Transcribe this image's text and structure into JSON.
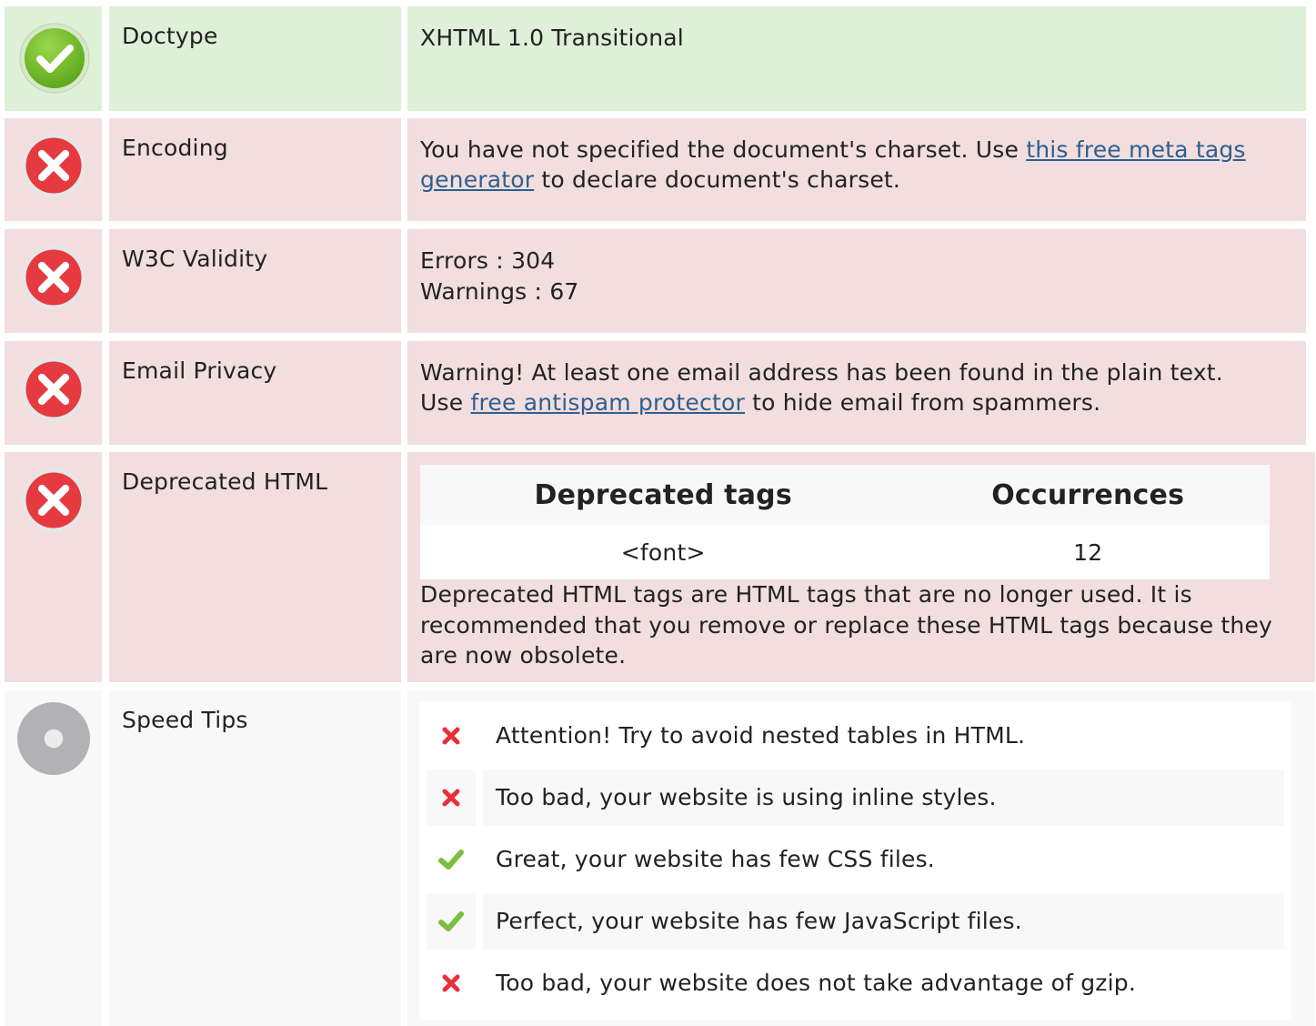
{
  "colors": {
    "ok_bg": "#dff0d8",
    "bad_bg": "#f2dede",
    "neutral_bg": "#f8f8f8",
    "link": "#2e5f8f",
    "cross": "#e8303a",
    "check": "#7cbf3e"
  },
  "doctype": {
    "label": "Doctype",
    "status_icon": "check-circle-icon",
    "value": "XHTML 1.0 Transitional"
  },
  "encoding": {
    "label": "Encoding",
    "status_icon": "error-circle-icon",
    "text_before": "You have not specified the document's charset. Use ",
    "link_text": "this free meta tags generator",
    "text_after": " to declare document's charset."
  },
  "w3c": {
    "label": "W3C Validity",
    "status_icon": "error-circle-icon",
    "errors": "Errors : 304",
    "warnings": "Warnings : 67"
  },
  "email": {
    "label": "Email Privacy",
    "status_icon": "error-circle-icon",
    "line1": "Warning! At least one email address has been found in the plain text.",
    "text_before": "Use ",
    "link_text": "free antispam protector",
    "text_after": " to hide email from spammers."
  },
  "deprecated": {
    "label": "Deprecated HTML",
    "status_icon": "error-circle-icon",
    "col_tags": "Deprecated tags",
    "col_occurrences": "Occurrences",
    "rows": [
      {
        "tag": "<font>",
        "count": "12"
      }
    ],
    "note": "Deprecated HTML tags are HTML tags that are no longer used. It is recommended that you remove or replace these HTML tags because they are now obsolete."
  },
  "speed": {
    "label": "Speed Tips",
    "status_icon": "neutral-circle-icon",
    "tips": [
      {
        "icon": "cross-icon",
        "text": "Attention! Try to avoid nested tables in HTML."
      },
      {
        "icon": "cross-icon",
        "text": "Too bad, your website is using inline styles."
      },
      {
        "icon": "check-icon",
        "text": "Great, your website has few CSS files."
      },
      {
        "icon": "check-icon",
        "text": "Perfect, your website has few JavaScript files."
      },
      {
        "icon": "cross-icon",
        "text": "Too bad, your website does not take advantage of gzip."
      }
    ]
  }
}
